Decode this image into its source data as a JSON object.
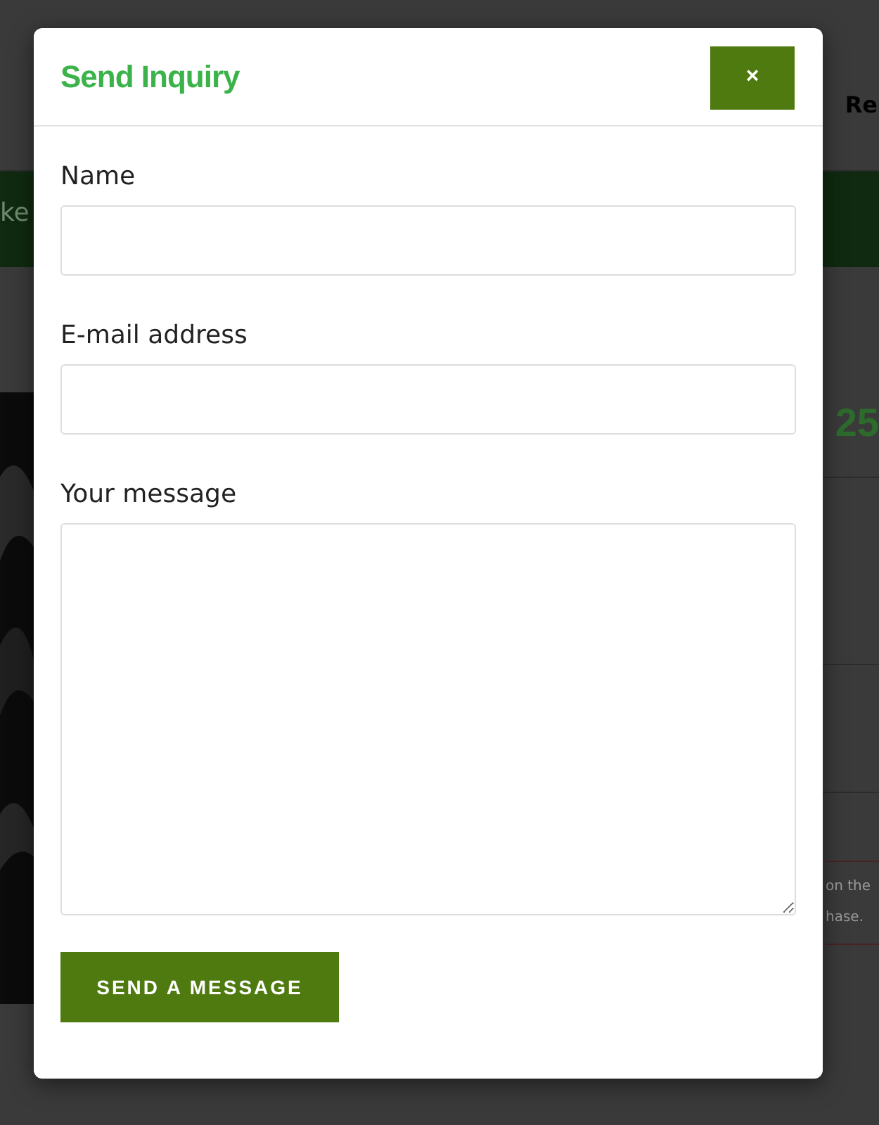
{
  "background": {
    "nav_text": "Re",
    "banner_text": "ke",
    "heading_text": "25",
    "notice_lines": [
      "on the",
      "hase."
    ]
  },
  "modal": {
    "title": "Send Inquiry",
    "close_label": "×",
    "fields": [
      {
        "label": "Name",
        "kind": "input"
      },
      {
        "label": "E-mail address",
        "kind": "input"
      },
      {
        "label": "Your message",
        "kind": "textarea"
      }
    ],
    "submit": "SEND A MESSAGE"
  }
}
